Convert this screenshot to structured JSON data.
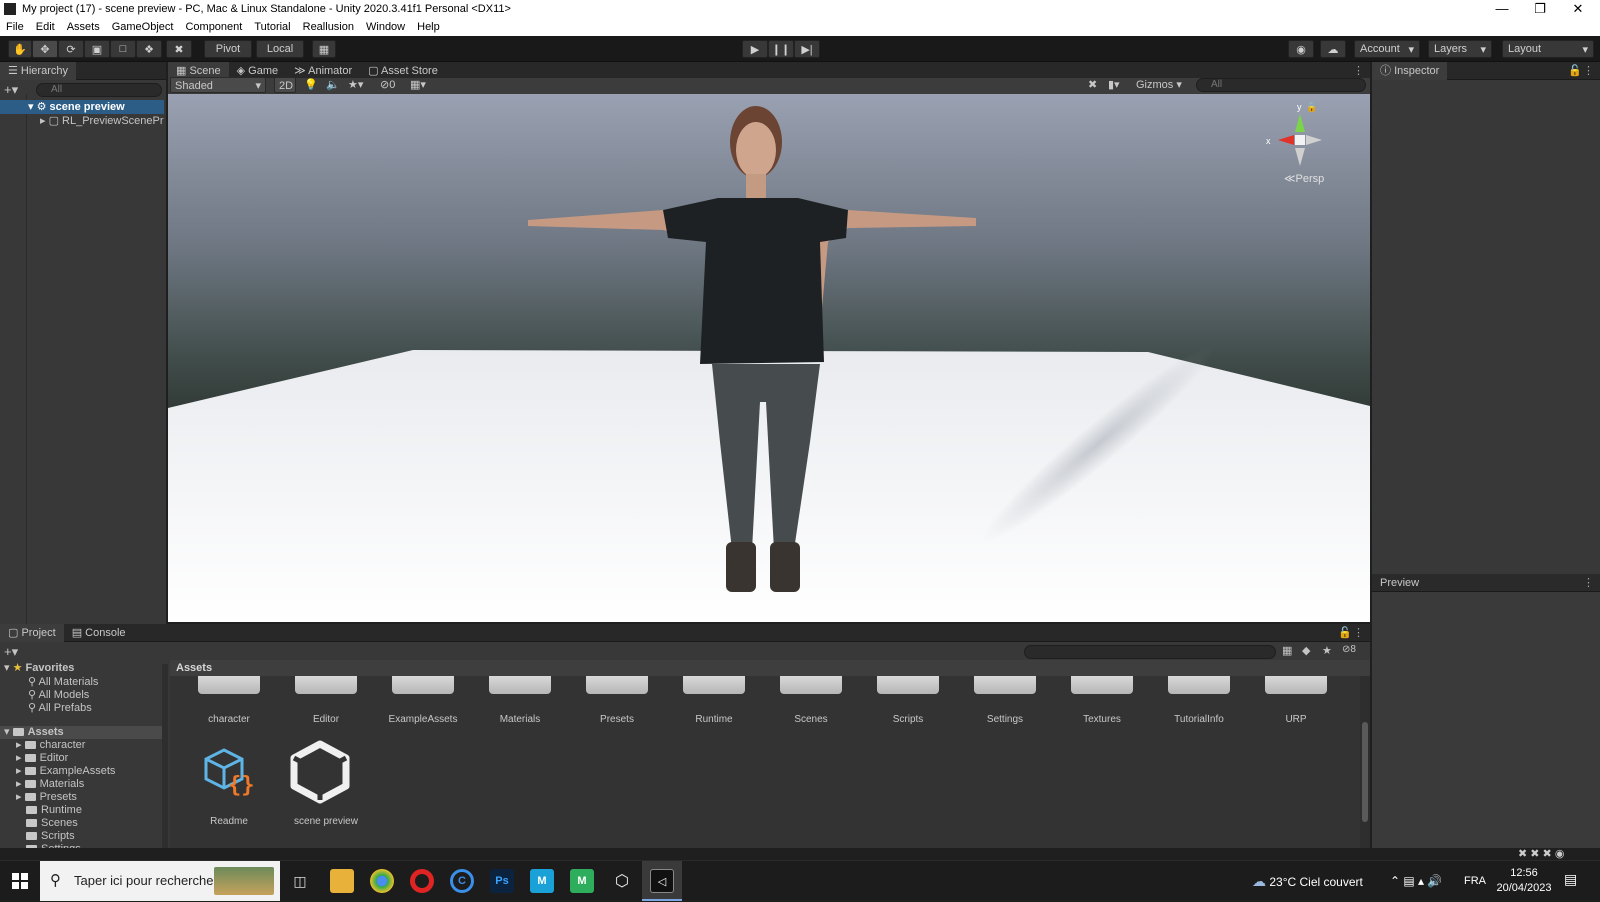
{
  "window": {
    "title": "My project (17) - scene preview - PC, Mac & Linux Standalone - Unity 2020.3.41f1 Personal <DX11>"
  },
  "menu": [
    "File",
    "Edit",
    "Assets",
    "GameObject",
    "Component",
    "Tutorial",
    "Reallusion",
    "Window",
    "Help"
  ],
  "toolbar": {
    "pivot": "Pivot",
    "local": "Local",
    "account": "Account",
    "layers": "Layers",
    "layout": "Layout"
  },
  "hierarchy": {
    "tab": "Hierarchy",
    "search_placeholder": "All",
    "items": [
      {
        "label": "scene preview"
      },
      {
        "label": "RL_PreviewScenePre"
      }
    ]
  },
  "scene_tabs": [
    "Scene",
    "Game",
    "Animator",
    "Asset Store"
  ],
  "scene_toolbar": {
    "shading": "Shaded",
    "mode2d": "2D",
    "hidden_count": "0",
    "gizmos": "Gizmos",
    "search_placeholder": "All"
  },
  "gizmo": {
    "y": "y",
    "x": "x",
    "persp": "Persp"
  },
  "inspector": {
    "tab": "Inspector",
    "preview": "Preview"
  },
  "project": {
    "tabs": [
      "Project",
      "Console"
    ],
    "breadcrumb": "Assets",
    "badge_count": "8",
    "favorites": {
      "label": "Favorites",
      "items": [
        "All Materials",
        "All Models",
        "All Prefabs"
      ]
    },
    "assets_root": "Assets",
    "tree": [
      "character",
      "Editor",
      "ExampleAssets",
      "Materials",
      "Presets",
      "Runtime",
      "Scenes",
      "Scripts",
      "Settings"
    ],
    "folders": [
      "character",
      "Editor",
      "ExampleAssets",
      "Materials",
      "Presets",
      "Runtime",
      "Scenes",
      "Scripts",
      "Settings",
      "Textures",
      "TutorialInfo",
      "URP"
    ],
    "files": [
      "Readme",
      "scene preview"
    ]
  },
  "taskbar": {
    "search_placeholder": "Taper ici pour rechercher",
    "weather": "23°C  Ciel couvert",
    "lang": "FRA",
    "time": "12:56",
    "date": "20/04/2023",
    "apps": [
      "file-explorer",
      "chrome",
      "opera",
      "ccleaner",
      "Ps",
      "M",
      "M",
      "unity-hub",
      "unity"
    ]
  },
  "colors": {
    "selection": "#2c5d87",
    "panel": "#383838",
    "toolbar": "#191919"
  }
}
